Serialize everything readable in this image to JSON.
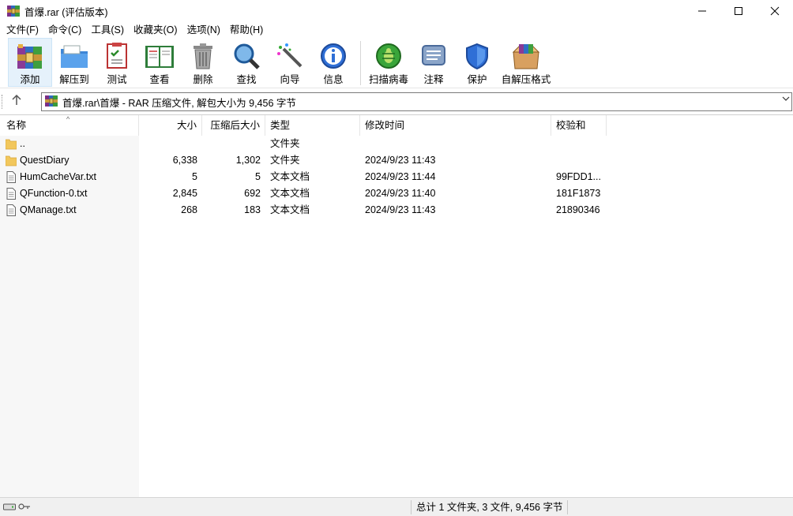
{
  "window": {
    "title": "首爆.rar (评估版本)",
    "controls": {
      "minimize": "—",
      "maximize": "☐",
      "close": "✕"
    }
  },
  "menu": [
    "文件(F)",
    "命令(C)",
    "工具(S)",
    "收藏夹(O)",
    "选项(N)",
    "帮助(H)"
  ],
  "toolbar": {
    "add": "添加",
    "extract": "解压到",
    "test": "测试",
    "view": "查看",
    "delete": "删除",
    "find": "查找",
    "wizard": "向导",
    "info": "信息",
    "virus": "扫描病毒",
    "comment": "注释",
    "protect": "保护",
    "sfx": "自解压格式"
  },
  "address": {
    "up_icon": "up-arrow-icon",
    "path": "首爆.rar\\首爆 - RAR 压缩文件, 解包大小为 9,456 字节"
  },
  "columns": {
    "name": "名称",
    "size": "大小",
    "packed": "压缩后大小",
    "type": "类型",
    "modified": "修改时间",
    "crc": "校验和"
  },
  "files": [
    {
      "name": "..",
      "size": "",
      "packed": "",
      "type": "文件夹",
      "modified": "",
      "crc": "",
      "icon": "folder-icon"
    },
    {
      "name": "QuestDiary",
      "size": "6,338",
      "packed": "1,302",
      "type": "文件夹",
      "modified": "2024/9/23 11:43",
      "crc": "",
      "icon": "folder-icon"
    },
    {
      "name": "HumCacheVar.txt",
      "size": "5",
      "packed": "5",
      "type": "文本文档",
      "modified": "2024/9/23 11:44",
      "crc": "99FDD1...",
      "icon": "text-file-icon"
    },
    {
      "name": "QFunction-0.txt",
      "size": "2,845",
      "packed": "692",
      "type": "文本文档",
      "modified": "2024/9/23 11:40",
      "crc": "181F1873",
      "icon": "text-file-icon"
    },
    {
      "name": "QManage.txt",
      "size": "268",
      "packed": "183",
      "type": "文本文档",
      "modified": "2024/9/23 11:43",
      "crc": "21890346",
      "icon": "text-file-icon"
    }
  ],
  "status": {
    "summary": "总计 1 文件夹, 3 文件, 9,456 字节"
  }
}
